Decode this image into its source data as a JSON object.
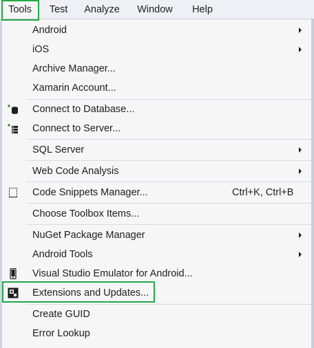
{
  "menubar": {
    "items": [
      {
        "label": "Tools"
      },
      {
        "label": "Test"
      },
      {
        "label": "Analyze"
      },
      {
        "label": "Window"
      },
      {
        "label": "Help"
      }
    ]
  },
  "dropdown": {
    "items": [
      {
        "label": "Android",
        "submenu": true
      },
      {
        "label": "iOS",
        "submenu": true
      },
      {
        "label": "Archive Manager..."
      },
      {
        "label": "Xamarin Account..."
      },
      {
        "label": "Connect to Database...",
        "icon": "connect-database-icon"
      },
      {
        "label": "Connect to Server...",
        "icon": "connect-server-icon"
      },
      {
        "label": "SQL Server",
        "submenu": true
      },
      {
        "label": "Web Code Analysis",
        "submenu": true
      },
      {
        "label": "Code Snippets Manager...",
        "shortcut": "Ctrl+K, Ctrl+B",
        "icon": "code-snippets-icon"
      },
      {
        "label": "Choose Toolbox Items..."
      },
      {
        "label": "NuGet Package Manager",
        "submenu": true
      },
      {
        "label": "Android Tools",
        "submenu": true
      },
      {
        "label": "Visual Studio Emulator for Android...",
        "icon": "phone-emulator-icon"
      },
      {
        "label": "Extensions and Updates...",
        "icon": "extensions-icon"
      },
      {
        "label": "Create GUID"
      },
      {
        "label": "Error Lookup"
      }
    ]
  },
  "colors": {
    "highlight": "#22a845",
    "menu_background": "#f6f6f6",
    "menubar_background": "#eef0f5",
    "text": "#1e1e1e"
  }
}
